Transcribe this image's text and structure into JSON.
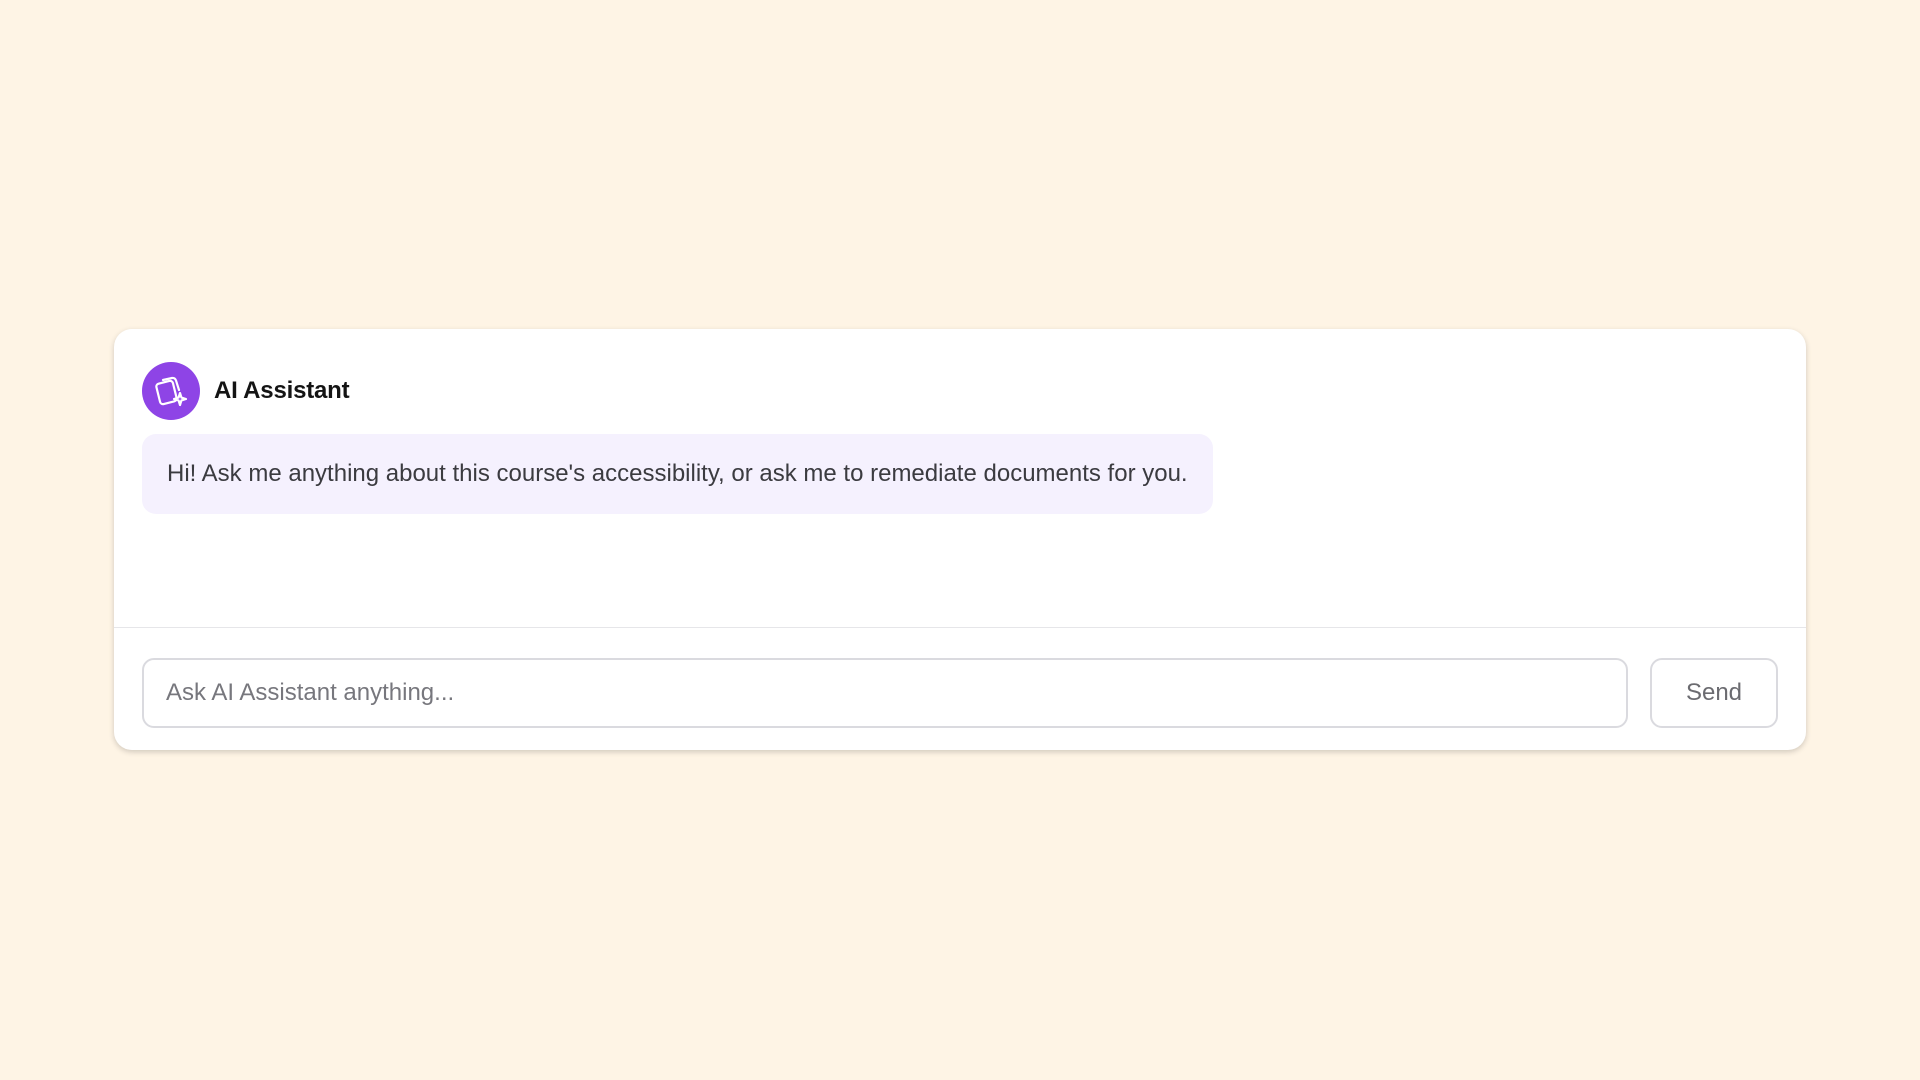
{
  "assistant": {
    "name": "AI Assistant",
    "avatar_icon": "document-sparkle-icon",
    "avatar_color": "#8E44E6"
  },
  "messages": [
    {
      "role": "assistant",
      "text": "Hi! Ask me anything about this course's accessibility, or ask me to remediate documents for you."
    }
  ],
  "composer": {
    "placeholder": "Ask AI Assistant anything...",
    "value": "",
    "send_label": "Send"
  },
  "colors": {
    "page_background": "#FEF4E5",
    "card_background": "#FFFFFF",
    "bubble_background": "#F5F1FE",
    "accent": "#8E44E6"
  }
}
